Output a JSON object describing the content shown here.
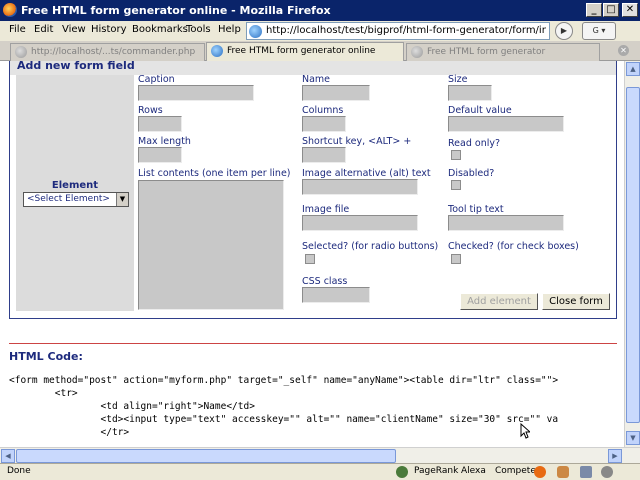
{
  "window": {
    "title": "Free HTML form generator online - Mozilla Firefox",
    "minimize": "_",
    "maximize": "□",
    "close": "✕"
  },
  "menu": [
    "File",
    "Edit",
    "View",
    "History",
    "Bookmarks",
    "Tools",
    "Help"
  ],
  "address": {
    "url": "http://localhost/test/bigprof/html-form-generator/form/ind"
  },
  "tabs": [
    {
      "label": "http://localhost/...ts/commander.php",
      "active": false
    },
    {
      "label": "Free HTML form generator online",
      "active": true
    },
    {
      "label": "Free HTML form generator",
      "active": false
    }
  ],
  "form_panel": {
    "heading": "Add new form field",
    "element_label": "Element",
    "element_select": "<Select Element>",
    "fields": {
      "caption": "Caption",
      "name": "Name",
      "size": "Size",
      "rows": "Rows",
      "columns": "Columns",
      "default_value": "Default value",
      "max_length": "Max length",
      "shortcut_key": "Shortcut key, <ALT> +",
      "read_only": "Read only?",
      "list_contents": "List contents (one item per line)",
      "image_alt": "Image alternative (alt) text",
      "disabled": "Disabled?",
      "image_file": "Image file",
      "tool_tip": "Tool tip text",
      "selected": "Selected? (for radio buttons)",
      "checked": "Checked? (for check boxes)",
      "css_class": "CSS class"
    },
    "add_button": "Add element",
    "close_button": "Close form"
  },
  "html_code": {
    "heading": "HTML Code:",
    "lines": [
      "<form method=\"post\" action=\"myform.php\" target=\"_self\" name=\"anyName\"><table dir=\"ltr\" class=\"\">",
      "        <tr>",
      "                <td align=\"right\">Name</td>",
      "                <td><input type=\"text\" accesskey=\"\" alt=\"\" name=\"clientName\" size=\"30\" src=\"\" va",
      "                </tr>"
    ]
  },
  "status": {
    "text": "Done",
    "pagerank": "PageRank",
    "alexa": "Alexa",
    "compete": "Compete"
  },
  "colors": {
    "label_blue": "#1d2a7d",
    "input_grey": "#c8c8c8",
    "title_bar": "#0a246a",
    "separator_red": "#cc4444"
  }
}
